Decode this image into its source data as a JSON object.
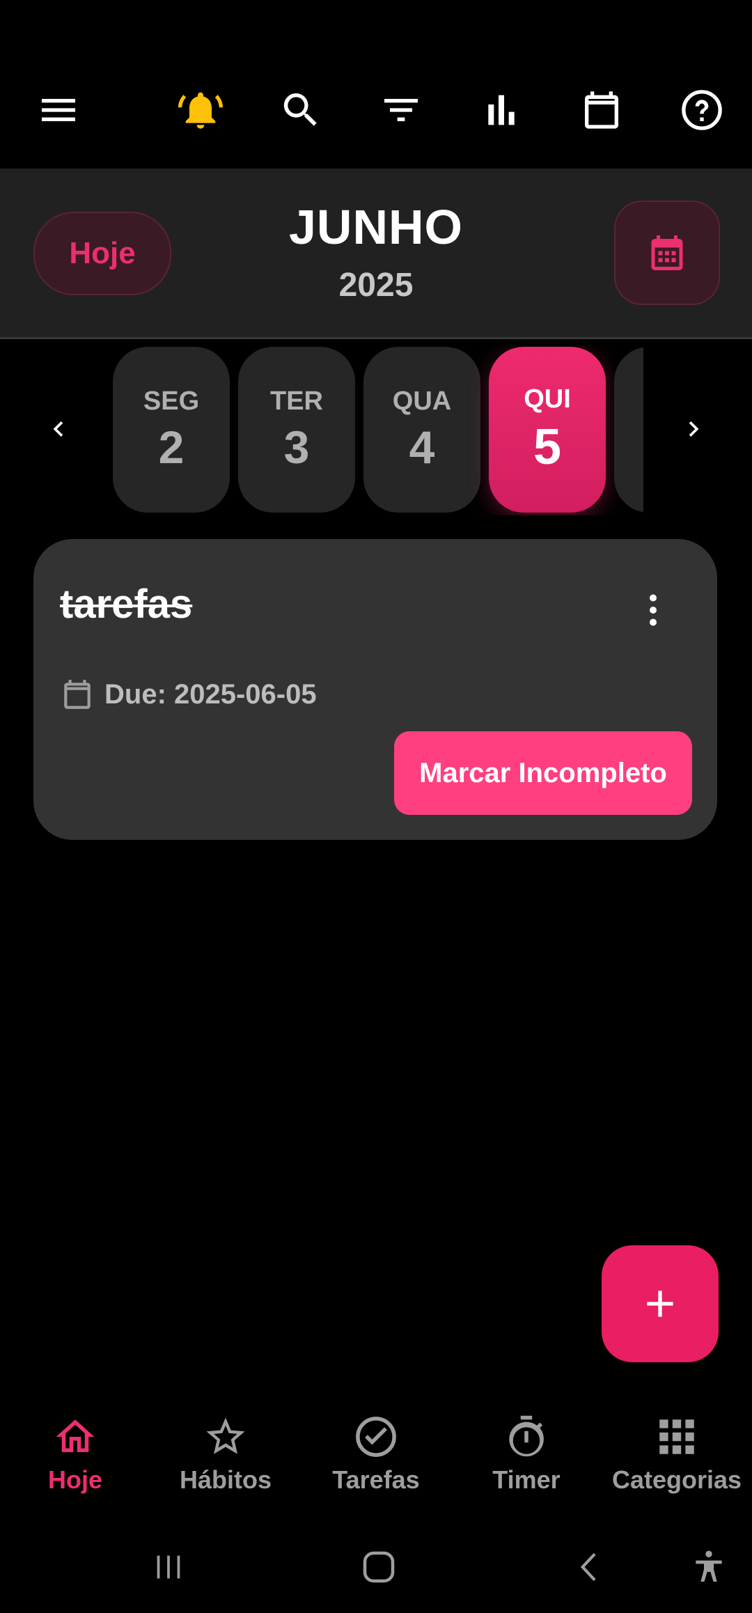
{
  "toolbar": {
    "icons": [
      "menu-icon",
      "bell-icon",
      "search-icon",
      "filter-icon",
      "bar-chart-icon",
      "calendar-icon",
      "help-icon"
    ],
    "bell_color": "#FFC107"
  },
  "header": {
    "today_label": "Hoje",
    "month": "JUNHO",
    "year": "2025",
    "accent": "#EC2F6E"
  },
  "days": [
    {
      "name": "SEG",
      "num": "2",
      "selected": false
    },
    {
      "name": "TER",
      "num": "3",
      "selected": false
    },
    {
      "name": "QUA",
      "num": "4",
      "selected": false
    },
    {
      "name": "QUI",
      "num": "5",
      "selected": true
    }
  ],
  "task": {
    "title": "tarefas",
    "completed": true,
    "due": "Due: 2025-06-05",
    "action_label": "Marcar Incompleto"
  },
  "fab": {
    "icon": "plus-icon"
  },
  "bottom_nav": [
    {
      "label": "Hoje",
      "icon": "home-icon",
      "active": true
    },
    {
      "label": "Hábitos",
      "icon": "star-icon",
      "active": false
    },
    {
      "label": "Tarefas",
      "icon": "check-circle-icon",
      "active": false
    },
    {
      "label": "Timer",
      "icon": "stopwatch-icon",
      "active": false
    },
    {
      "label": "Categorias",
      "icon": "grid-icon",
      "active": false
    }
  ],
  "system_nav": [
    "recents-icon",
    "home-button-icon",
    "back-icon",
    "accessibility-icon"
  ]
}
